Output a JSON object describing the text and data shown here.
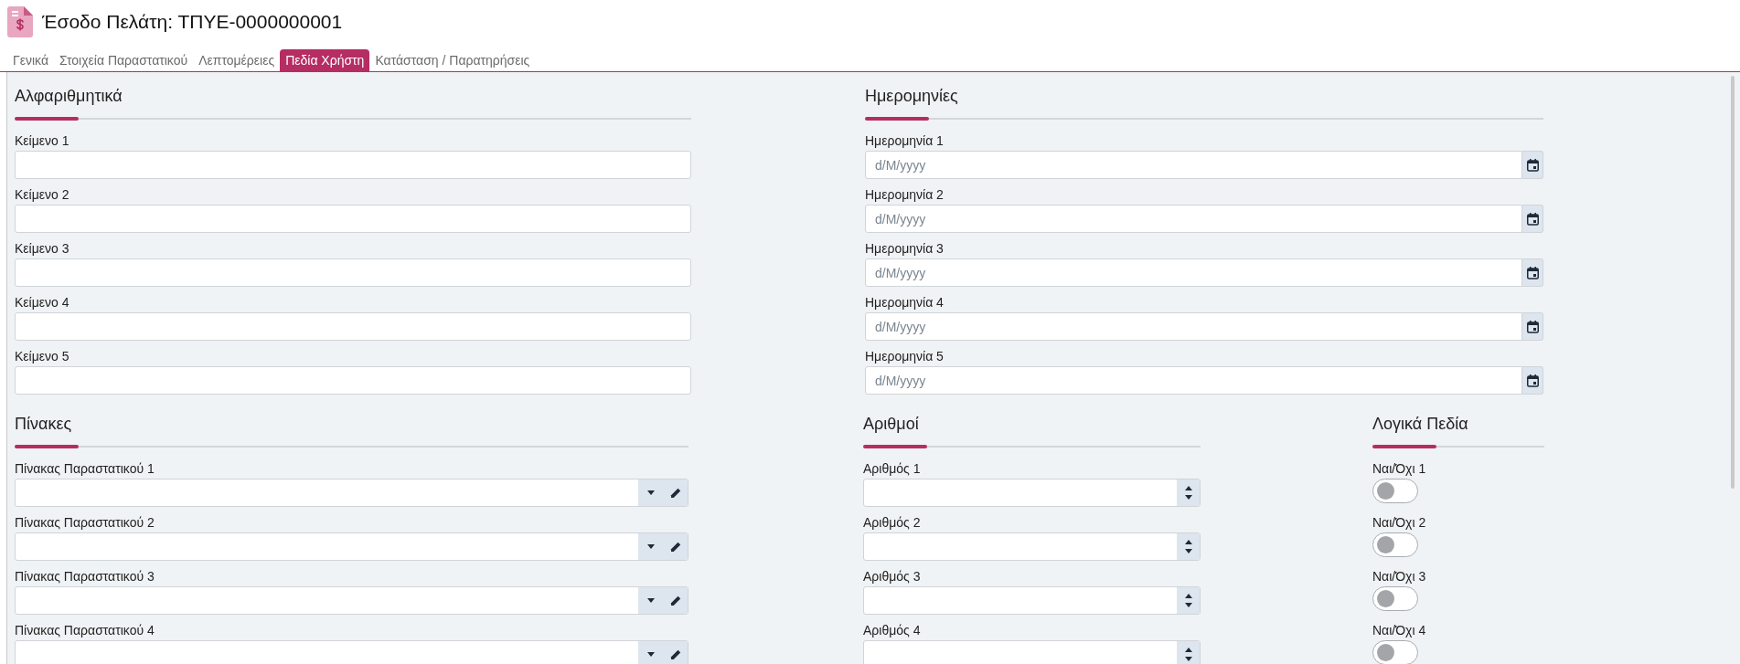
{
  "header": {
    "title": "Έσοδο Πελάτη: ΤΠΥΕ-0000000001"
  },
  "tabs": [
    {
      "label": "Γενικά",
      "selected": false
    },
    {
      "label": "Στοιχεία Παραστατικού",
      "selected": false
    },
    {
      "label": "Λεπτομέρειες",
      "selected": false
    },
    {
      "label": "Πεδία Χρήστη",
      "selected": true
    },
    {
      "label": "Κατάσταση / Παρατηρήσεις",
      "selected": false
    }
  ],
  "text_fields": {
    "heading": "Αλφαριθμητικά",
    "fields": [
      {
        "label": "Κείμενο 1"
      },
      {
        "label": "Κείμενο 2"
      },
      {
        "label": "Κείμενο 3"
      },
      {
        "label": "Κείμενο 4"
      },
      {
        "label": "Κείμενο 5"
      }
    ]
  },
  "date_fields": {
    "heading": "Ημερομηνίες",
    "fields": [
      {
        "label": "Ημερομηνία 1",
        "placeholder": "d/M/yyyy"
      },
      {
        "label": "Ημερομηνία 2",
        "placeholder": "d/M/yyyy"
      },
      {
        "label": "Ημερομηνία 3",
        "placeholder": "d/M/yyyy"
      },
      {
        "label": "Ημερομηνία 4",
        "placeholder": "d/M/yyyy"
      },
      {
        "label": "Ημερομηνία 5",
        "placeholder": "d/M/yyyy"
      }
    ]
  },
  "table_fields": {
    "heading": "Πίνακες",
    "fields": [
      {
        "label": "Πίνακας Παραστατικού 1"
      },
      {
        "label": "Πίνακας Παραστατικού 2"
      },
      {
        "label": "Πίνακας Παραστατικού 3"
      },
      {
        "label": "Πίνακας Παραστατικού 4"
      }
    ]
  },
  "number_fields": {
    "heading": "Αριθμοί",
    "fields": [
      {
        "label": "Αριθμός 1"
      },
      {
        "label": "Αριθμός 2"
      },
      {
        "label": "Αριθμός 3"
      },
      {
        "label": "Αριθμός 4"
      }
    ]
  },
  "boolean_fields": {
    "heading": "Λογικά Πεδία",
    "fields": [
      {
        "label": "Ναι/Όχι 1",
        "on": false
      },
      {
        "label": "Ναι/Όχι 2",
        "on": false
      },
      {
        "label": "Ναι/Όχι 3",
        "on": false
      },
      {
        "label": "Ναι/Όχι 4",
        "on": false
      }
    ]
  }
}
